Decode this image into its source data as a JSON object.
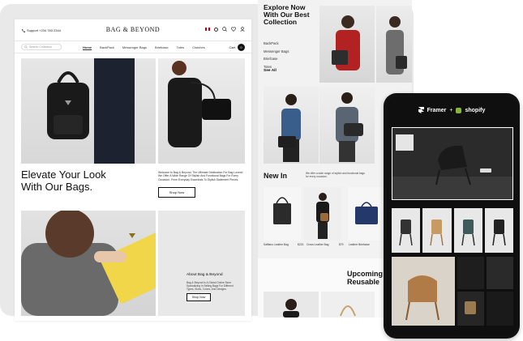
{
  "store": {
    "brand": "BAG & BEYOND",
    "phone": "Support +234 783 2344",
    "search_placeholder": "Search Collection",
    "nav": [
      "Home",
      "BackPack",
      "Messenger Bags",
      "Briefcase",
      "Totes",
      "Clutches"
    ],
    "cart_label": "Cart",
    "cart_count": "0"
  },
  "hero": {
    "headline": "Elevate Your Look\nWith Our Bags.",
    "description": "Welcome to Bag & Beyond, The Ultimate Destination For Bag Lovers! We Offer A Wide Range Of Stylish And Functional Bags For Every Occasion. From Everyday Essentials To Stylish Statement Pieces.",
    "cta": "Shop Now"
  },
  "about": {
    "title": "About Bag & Beyond",
    "text": "Bag & Beyond Is A Global Online Store Specializing In Selling Bags For Different Types, Sizes, Colors, And Designs.",
    "cta": "Shop Now"
  },
  "explore": {
    "title": "Explore Now\nWith Our Best\nCollection",
    "categories": [
      "BackPack",
      "Messenger Bags",
      "Briefcase",
      "Totes"
    ],
    "see_all": "See All"
  },
  "new_in": {
    "title": "New In",
    "description": "We offer a wide range of stylish and functional bags for every occasion.",
    "products": [
      {
        "name": "Saffiano Leather Bag",
        "price": "$215"
      },
      {
        "name": "Cross Leather Bag",
        "price": "$79"
      },
      {
        "name": "Leather Briefcase",
        "price": "$95"
      }
    ]
  },
  "upcoming": {
    "title": "Upcoming\nReusable"
  },
  "mobile": {
    "framer_label": "Framer",
    "separator": "+",
    "shopify_label": "shopify"
  },
  "colors": {
    "background_card": "#e9e9e9",
    "dark_device": "#111111",
    "accent_yellow": "#f1d64a",
    "shopify_green": "#8ab33b"
  }
}
